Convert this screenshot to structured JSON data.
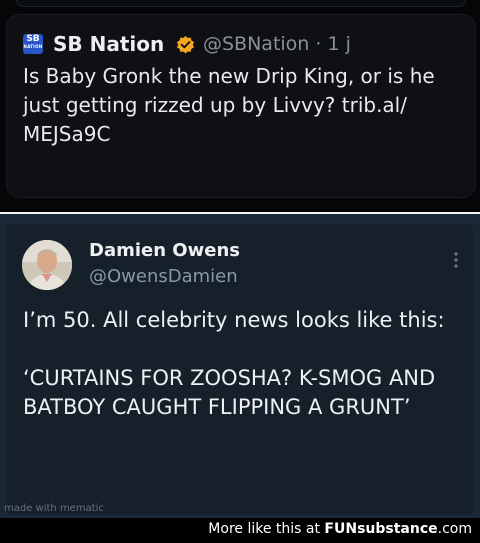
{
  "top_tweet": {
    "author_name": "SB Nation",
    "handle_time": "@SBNation · 1 j",
    "text": "Is Baby Gronk the new Drip King, or is he just getting rizzed up by Livvy? trib.al/ MEJSa9C",
    "logo_text_main": "SB",
    "logo_text_sub": "NATION"
  },
  "bottom_tweet": {
    "author_name": "Damien Owens",
    "handle": "@OwensDamien",
    "text": "I’m 50. All celebrity news looks like this:\n\n‘CURTAINS FOR ZOOSHA? K-SMOG AND BATBOY CAUGHT FLIPPING A GRUNT’"
  },
  "watermark": "made with mematic",
  "footer": {
    "prefix": "More like this at ",
    "brand_a": "FUN",
    "brand_b": "substance",
    "suffix": ".com"
  },
  "colors": {
    "verified": "#f5a623",
    "sb_blue": "#2a55c9",
    "dark_card": "#15202b"
  }
}
